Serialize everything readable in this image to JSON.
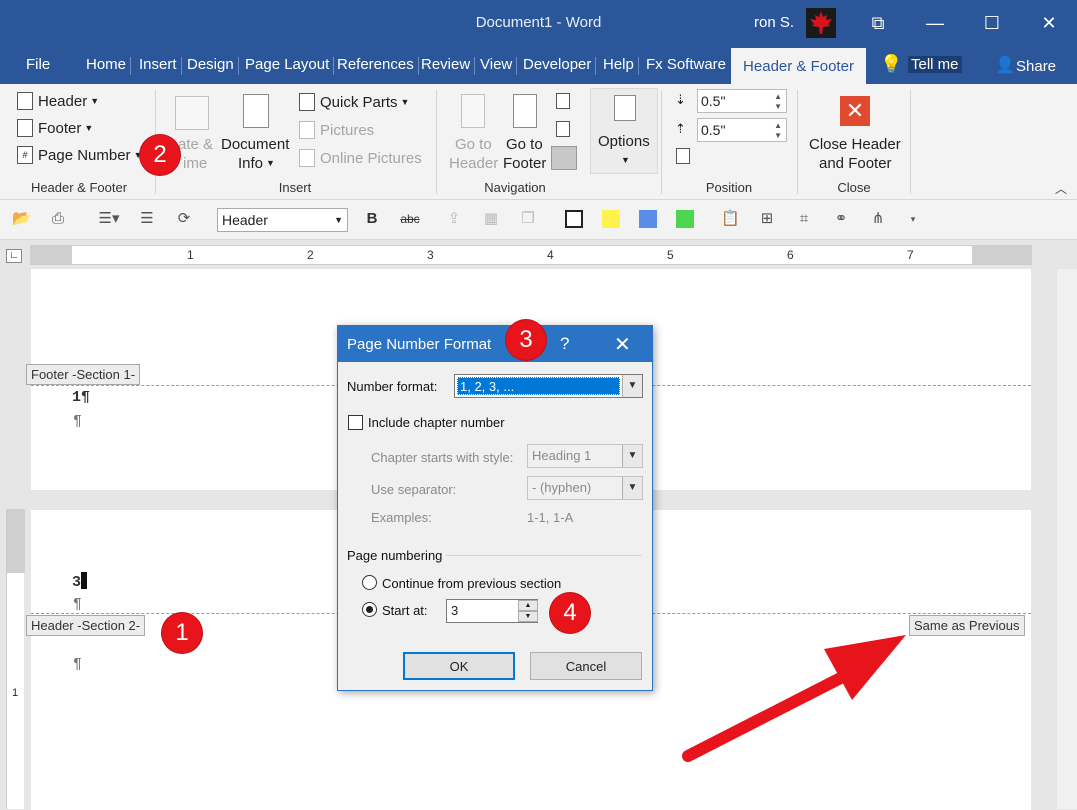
{
  "window": {
    "title": "Document1  -  Word",
    "user": "ron S.",
    "controls": {
      "restore_ribbon": "⧉",
      "minimize": "—",
      "maximize": "☐",
      "close": "✕"
    }
  },
  "tabs": {
    "file": "File",
    "home": "Home",
    "insert": "Insert",
    "design": "Design",
    "page_layout": "Page Layout",
    "references": "References",
    "review": "Review",
    "view": "View",
    "developer": "Developer",
    "help": "Help",
    "fx": "Fx Software",
    "header_footer": "Header & Footer",
    "tell_me": "Tell me",
    "share": "Share"
  },
  "ribbon": {
    "hf_group": {
      "header": "Header",
      "footer": "Footer",
      "page_number": "Page Number",
      "label": "Header & Footer"
    },
    "insert_group": {
      "date_time_1": "ate &",
      "date_time_2": "ime",
      "doc_info_1": "Document",
      "doc_info_2": "Info",
      "quick_parts": "Quick Parts",
      "pictures": "Pictures",
      "online_pictures": "Online Pictures",
      "label": "Insert"
    },
    "nav_group": {
      "goto_header_1": "Go to",
      "goto_header_2": "Header",
      "goto_footer_1": "Go to",
      "goto_footer_2": "Footer",
      "label": "Navigation"
    },
    "options_group": {
      "options": "Options"
    },
    "position_group": {
      "header_pos": "0.5\"",
      "footer_pos": "0.5\"",
      "label": "Position"
    },
    "close_group": {
      "close_1": "Close Header",
      "close_2": "and Footer",
      "label": "Close"
    }
  },
  "toolbar": {
    "style": "Header",
    "bold": "B",
    "strike": "abc"
  },
  "colors": {
    "accent": "#2b579a",
    "yellow": "#fff24d",
    "blue": "#5a8ee6",
    "green": "#4fd64f",
    "callout": "#e8141c"
  },
  "ruler": {
    "marks": [
      "1",
      "2",
      "3",
      "4",
      "5",
      "6",
      "7"
    ],
    "vmark": "1"
  },
  "document": {
    "footer_tag": "Footer -Section 1-",
    "header_tag": "Header -Section 2-",
    "same_as_previous": "Same as Previous",
    "page1_num": "1¶",
    "pilcrow": "¶",
    "page2_num": "3"
  },
  "callouts": [
    "1",
    "2",
    "3",
    "4"
  ],
  "dialog": {
    "title": "Page Number Format",
    "help": "?",
    "close": "✕",
    "number_format_label": "Number format:",
    "number_format_value": "1, 2, 3, ...",
    "include_chapter": "Include chapter number",
    "chapter_style_label": "Chapter starts with style:",
    "chapter_style_value": "Heading 1",
    "separator_label": "Use separator:",
    "separator_value": "-   (hyphen)",
    "examples_label": "Examples:",
    "examples_value": "1-1, 1-A",
    "page_numbering": "Page numbering",
    "continue_label": "Continue from previous section",
    "start_at_label": "Start at:",
    "start_at_value": "3",
    "ok": "OK",
    "cancel": "Cancel"
  }
}
